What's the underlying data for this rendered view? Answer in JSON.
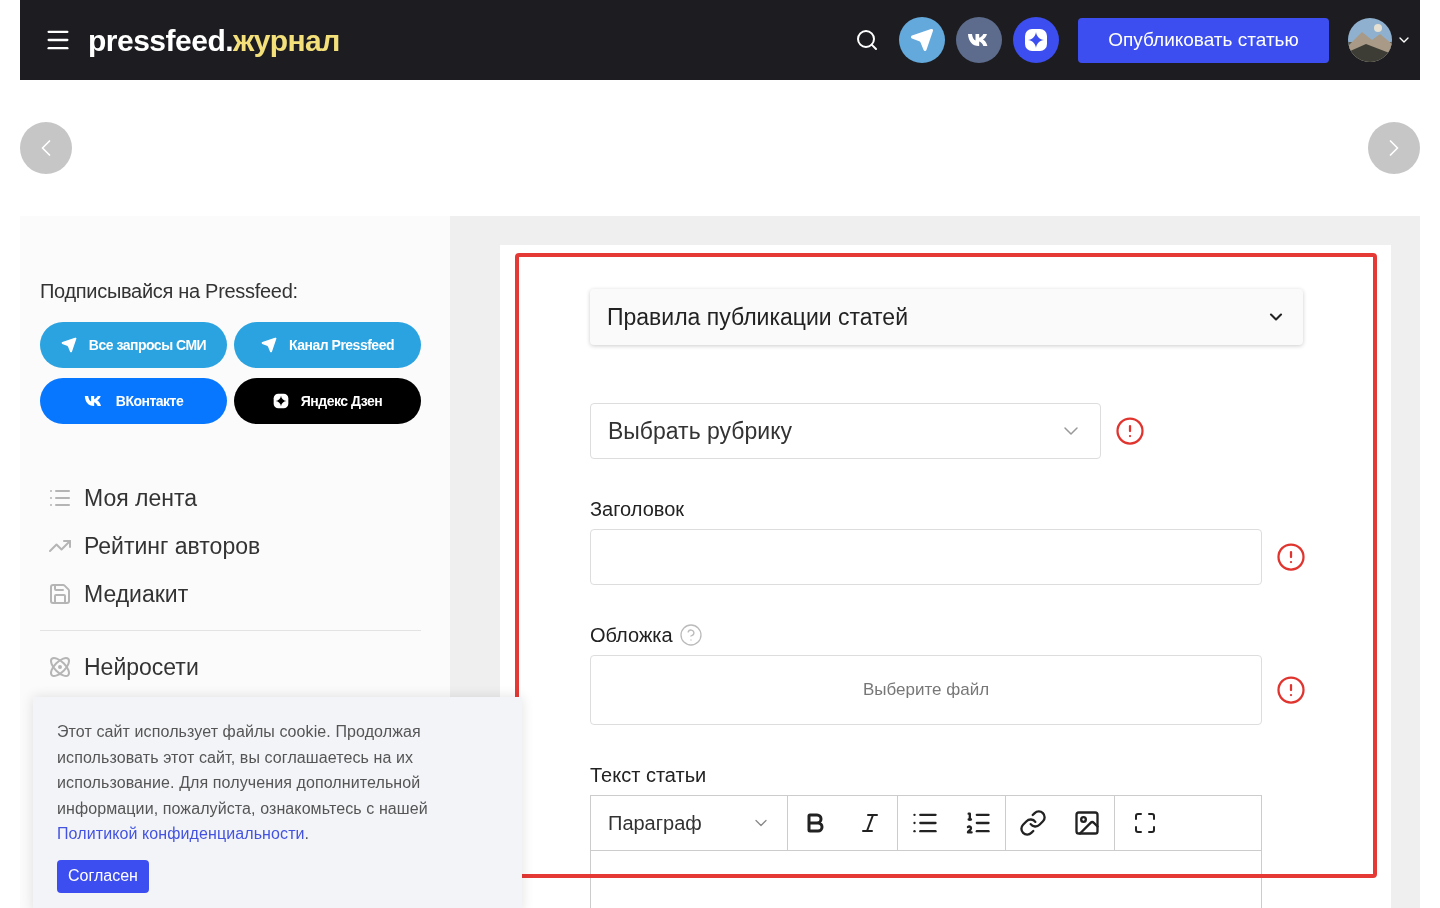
{
  "header": {
    "logo_main": "pressfeed.",
    "logo_accent": "журнал",
    "social": [
      {
        "kind": "telegram"
      },
      {
        "kind": "vk"
      },
      {
        "kind": "zen"
      }
    ],
    "publish_button": "Опубликовать статью"
  },
  "sidebar": {
    "subscribe_title": "Подписывайся на Pressfeed:",
    "social_buttons": [
      {
        "label": "Все запросы СМИ",
        "kind": "telegram"
      },
      {
        "label": "Канал Pressfeed",
        "kind": "telegram"
      },
      {
        "label": "ВКонтакте",
        "kind": "vk"
      },
      {
        "label": "Яндекс Дзен",
        "kind": "zen"
      }
    ],
    "nav_groups": [
      [
        {
          "label": "Моя лента",
          "kind": "list"
        },
        {
          "label": "Рейтинг авторов",
          "kind": "chart"
        },
        {
          "label": "Медиакит",
          "kind": "doc"
        }
      ],
      [
        {
          "label": "Нейросети",
          "kind": "ai"
        }
      ]
    ]
  },
  "form": {
    "rules_dropdown": "Правила публикации статей",
    "category_select": {
      "placeholder": "Выбрать рубрику",
      "required": true
    },
    "title_field": {
      "label": "Заголовок",
      "required": true
    },
    "cover_field": {
      "label": "Обложка",
      "placeholder": "Выберите файл",
      "required": true
    },
    "text_field": {
      "label": "Текст статьи",
      "block_format": "Параграф"
    }
  },
  "cookie_banner": {
    "text": "Этот сайт использует файлы cookie. Продолжая использовать этот сайт, вы соглашаетесь на их использование. Для получения дополнительной информации, пожалуйста, ознакомьтесь с нашей",
    "link": "Политикой конфиденциальности",
    "after_link": ".",
    "accept_button": "Согласен"
  }
}
